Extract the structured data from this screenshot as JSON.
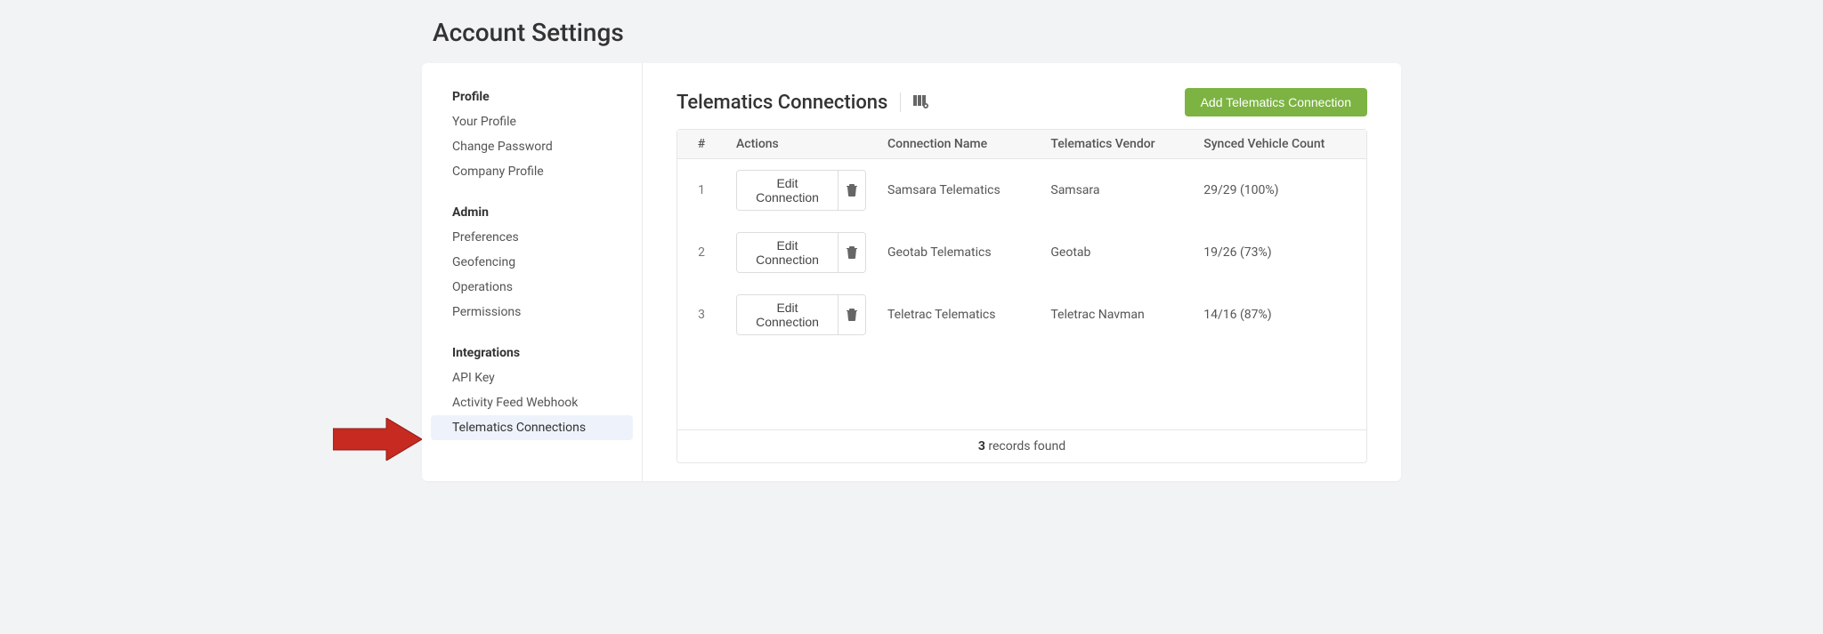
{
  "page": {
    "title": "Account Settings"
  },
  "sidebar": {
    "sections": [
      {
        "title": "Profile",
        "items": [
          {
            "label": "Your Profile",
            "active": false
          },
          {
            "label": "Change Password",
            "active": false
          },
          {
            "label": "Company Profile",
            "active": false
          }
        ]
      },
      {
        "title": "Admin",
        "items": [
          {
            "label": "Preferences",
            "active": false
          },
          {
            "label": "Geofencing",
            "active": false
          },
          {
            "label": "Operations",
            "active": false
          },
          {
            "label": "Permissions",
            "active": false
          }
        ]
      },
      {
        "title": "Integrations",
        "items": [
          {
            "label": "API Key",
            "active": false
          },
          {
            "label": "Activity Feed Webhook",
            "active": false
          },
          {
            "label": "Telematics Connections",
            "active": true
          }
        ]
      }
    ]
  },
  "content": {
    "title": "Telematics Connections",
    "add_button": "Add Telematics Connection",
    "columns": {
      "num": "#",
      "actions": "Actions",
      "connection_name": "Connection Name",
      "vendor": "Telematics Vendor",
      "count": "Synced Vehicle Count"
    },
    "edit_label": "Edit Connection",
    "rows": [
      {
        "num": "1",
        "name": "Samsara Telematics",
        "vendor": "Samsara",
        "count": "29/29 (100%)"
      },
      {
        "num": "2",
        "name": "Geotab Telematics",
        "vendor": "Geotab",
        "count": "19/26 (73%)"
      },
      {
        "num": "3",
        "name": "Teletrac Telematics",
        "vendor": "Teletrac Navman",
        "count": "14/16 (87%)"
      }
    ],
    "footer": {
      "count": "3",
      "label": " records found"
    }
  }
}
